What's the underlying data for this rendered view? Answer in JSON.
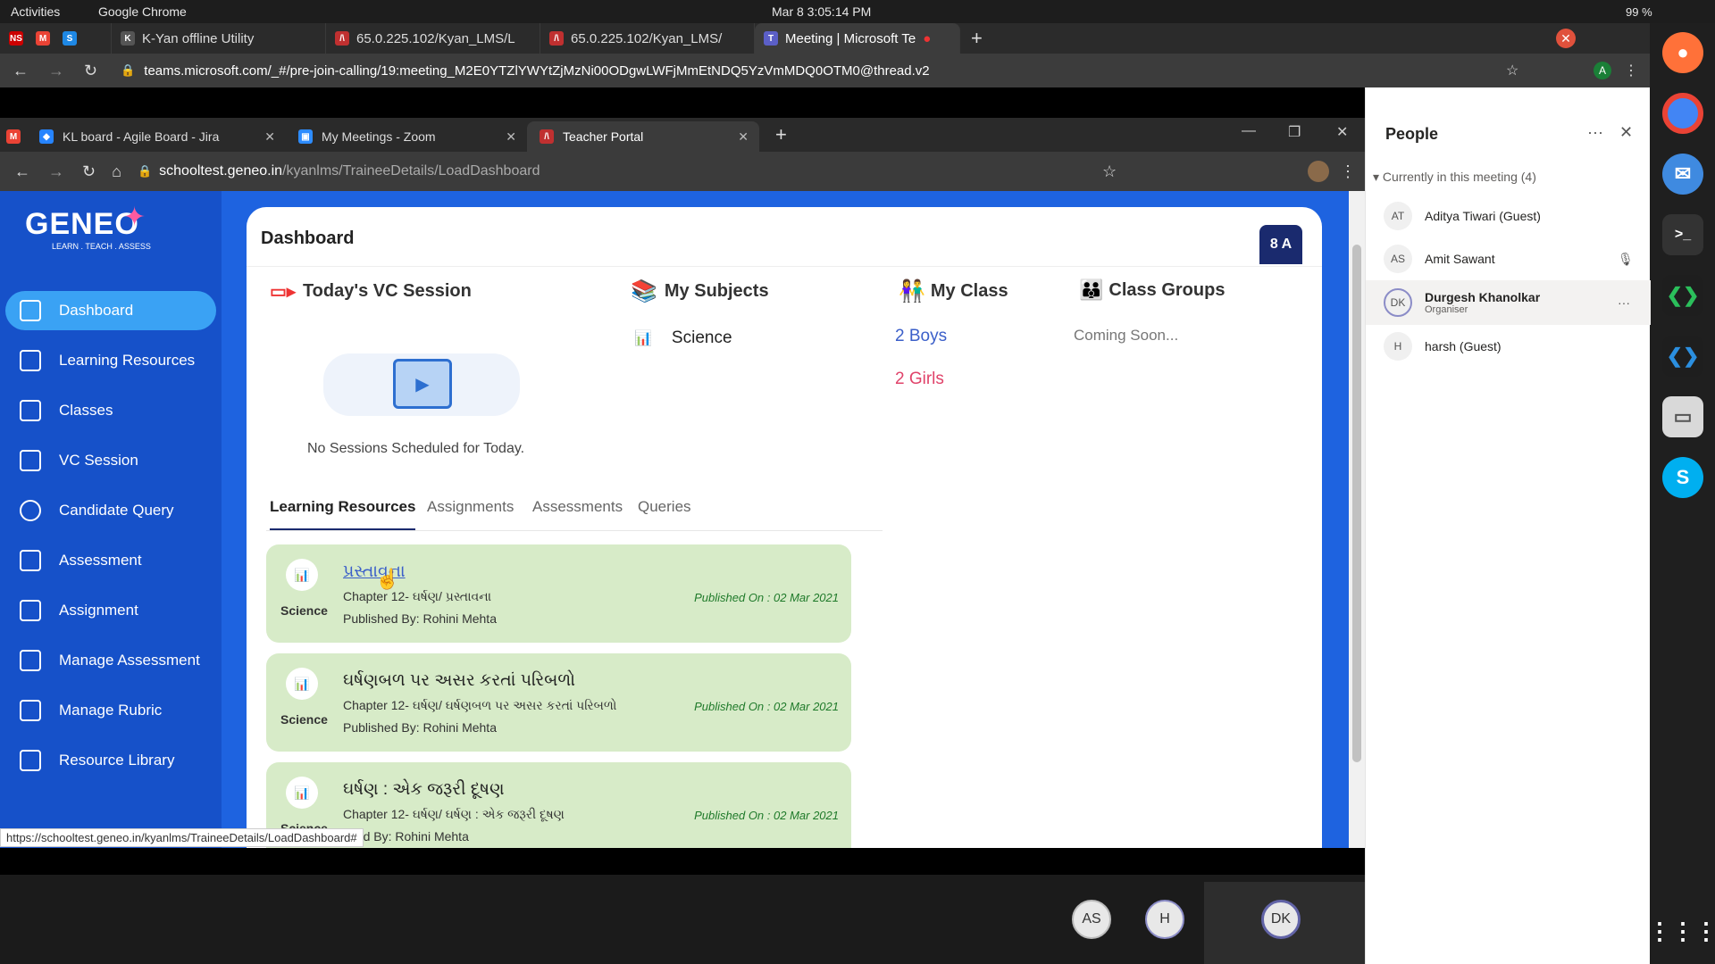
{
  "gnome": {
    "activities": "Activities",
    "app": "Google Chrome",
    "clock": "Mar 8  3:05:14 PM",
    "battery": "99 %"
  },
  "os_tabs": [
    {
      "label": "K-Yan offline Utility"
    },
    {
      "label": "65.0.225.102/Kyan_LMS/L"
    },
    {
      "label": "65.0.225.102/Kyan_LMS/"
    },
    {
      "label": "Meeting | Microsoft Te"
    }
  ],
  "os_url": "teams.microsoft.com/_#/pre-join-calling/19:meeting_M2E0YTZlYWYtZjMzNi00ODgwLWFjMmEtNDQ5YzVmMDQ0OTM0@thread.v2",
  "inner_tabs": [
    {
      "label": "KL board - Agile Board - Jira"
    },
    {
      "label": "My Meetings - Zoom"
    },
    {
      "label": "Teacher Portal"
    }
  ],
  "inner_url": {
    "host": "schooltest.geneo.in",
    "path": "/kyanlms/TraineeDetails/LoadDashboard"
  },
  "logo": {
    "name": "GENEO",
    "tagline": "LEARN . TEACH . ASSESS"
  },
  "nav": [
    "Dashboard",
    "Learning Resources",
    "Classes",
    "VC Session",
    "Candidate Query",
    "Assessment",
    "Assignment",
    "Manage Assessment",
    "Manage Rubric",
    "Resource Library"
  ],
  "dashboard": {
    "title": "Dashboard",
    "class_badge": "8 A"
  },
  "vc": {
    "title": "Today's VC Session",
    "empty": "No Sessions Scheduled for Today."
  },
  "subjects": {
    "title": "My Subjects",
    "items": [
      "Science"
    ]
  },
  "myclass": {
    "title": "My Class",
    "boys": "2 Boys",
    "girls": "2 Girls"
  },
  "groups": {
    "title": "Class Groups",
    "status": "Coming Soon..."
  },
  "lr_tabs": [
    "Learning Resources",
    "Assignments",
    "Assessments",
    "Queries"
  ],
  "resources": [
    {
      "subject": "Science",
      "title": "પ્રસ્તાવના",
      "chapter": "Chapter 12- ઘર્ષણ/ પ્રસ્તાવના",
      "published_by": "Published By: Rohini Mehta",
      "published_on": "Published On : 02 Mar 2021"
    },
    {
      "subject": "Science",
      "title": "ઘર્ષણબળ પર અસર કરતાં પરિબળો",
      "chapter": "Chapter 12- ઘર્ષણ/ ઘર્ષણબળ પર અસર કરતાં પરિબળો",
      "published_by": "Published By: Rohini Mehta",
      "published_on": "Published On : 02 Mar 2021"
    },
    {
      "subject": "Science",
      "title": "ઘર્ષણ : એક જરૂરી દૂષણ",
      "chapter": "Chapter 12- ઘર્ષણ/ ઘર્ષણ : એક જરૂરી દૂષણ",
      "published_by": "shed By: Rohini Mehta",
      "published_on": "Published On : 02 Mar 2021"
    }
  ],
  "status_url": "https://schooltest.geneo.in/kyanlms/TraineeDetails/LoadDashboard#",
  "people": {
    "title": "People",
    "section": "Currently in this meeting (4)",
    "members": [
      {
        "initials": "AT",
        "name": "Aditya Tiwari (Guest)",
        "role": ""
      },
      {
        "initials": "AS",
        "name": "Amit Sawant",
        "role": ""
      },
      {
        "initials": "DK",
        "name": "Durgesh Khanolkar",
        "role": "Organiser"
      },
      {
        "initials": "H",
        "name": "harsh (Guest)",
        "role": ""
      }
    ]
  },
  "bottom_avatars": [
    "AS",
    "H",
    "DK"
  ],
  "colors": {
    "sidebar": "#1651c9",
    "accent": "#3aa2f4",
    "boys": "#3b5fc9",
    "girls": "#e0436a"
  }
}
